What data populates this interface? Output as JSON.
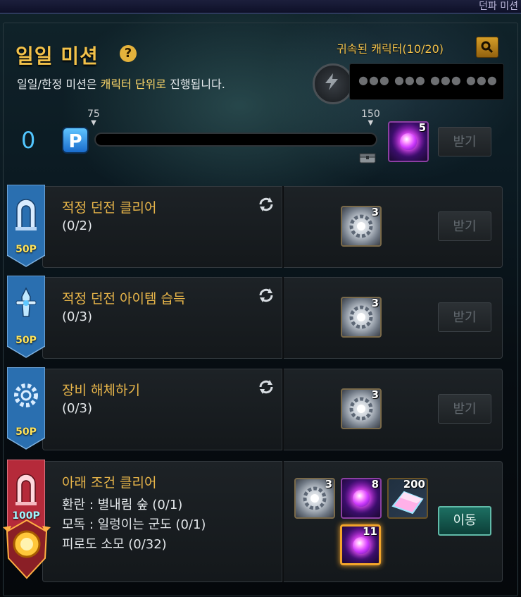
{
  "window": {
    "header_partial": "던파 미션"
  },
  "header": {
    "title": "일일 미션",
    "help_symbol": "?",
    "subtitle_pre": "일일/한정 미션은 ",
    "subtitle_highlight": "캐릭터 단위로",
    "subtitle_post": " 진행됩니다.",
    "bound_character_label": "귀속된 캐릭터(10/20)",
    "character_name_masked": "●●● ●●● ●●● ●●●"
  },
  "progress": {
    "current_points": "0",
    "point_icon_letter": "P",
    "current_value": 0,
    "max_value": 150,
    "marker_75": "75",
    "marker_150": "150",
    "reward_item_count": "5",
    "claim_label": "받기"
  },
  "missions": [
    {
      "points": "50P",
      "name": "적정 던전 클리어",
      "progress": "(0/2)",
      "reward_count": "3",
      "button": "받기",
      "banner_icon": "gate-icon"
    },
    {
      "points": "50P",
      "name": "적정 던전 아이템 습득",
      "progress": "(0/3)",
      "reward_count": "3",
      "button": "받기",
      "banner_icon": "sword-icon"
    },
    {
      "points": "50P",
      "name": "장비 해체하기",
      "progress": "(0/3)",
      "reward_count": "3",
      "button": "받기",
      "banner_icon": "gear-icon"
    },
    {
      "points": "100P",
      "name": "아래 조건 클리어",
      "conditions": [
        "환란 : 별내림 숲 (0/1)",
        "모독 : 일렁이는 군도 (0/1)",
        "피로도 소모 (0/32)"
      ],
      "rewards": [
        "3",
        "8",
        "200",
        "11"
      ],
      "button": "이동",
      "banner_icon": "gate-icon"
    }
  ],
  "colors": {
    "accent_gold": "#f2c24c",
    "point_blue": "#52c6ff",
    "banner_blue": "#2a6fb0",
    "banner_red": "#b52a3a",
    "move_button": "#1d6f62"
  }
}
